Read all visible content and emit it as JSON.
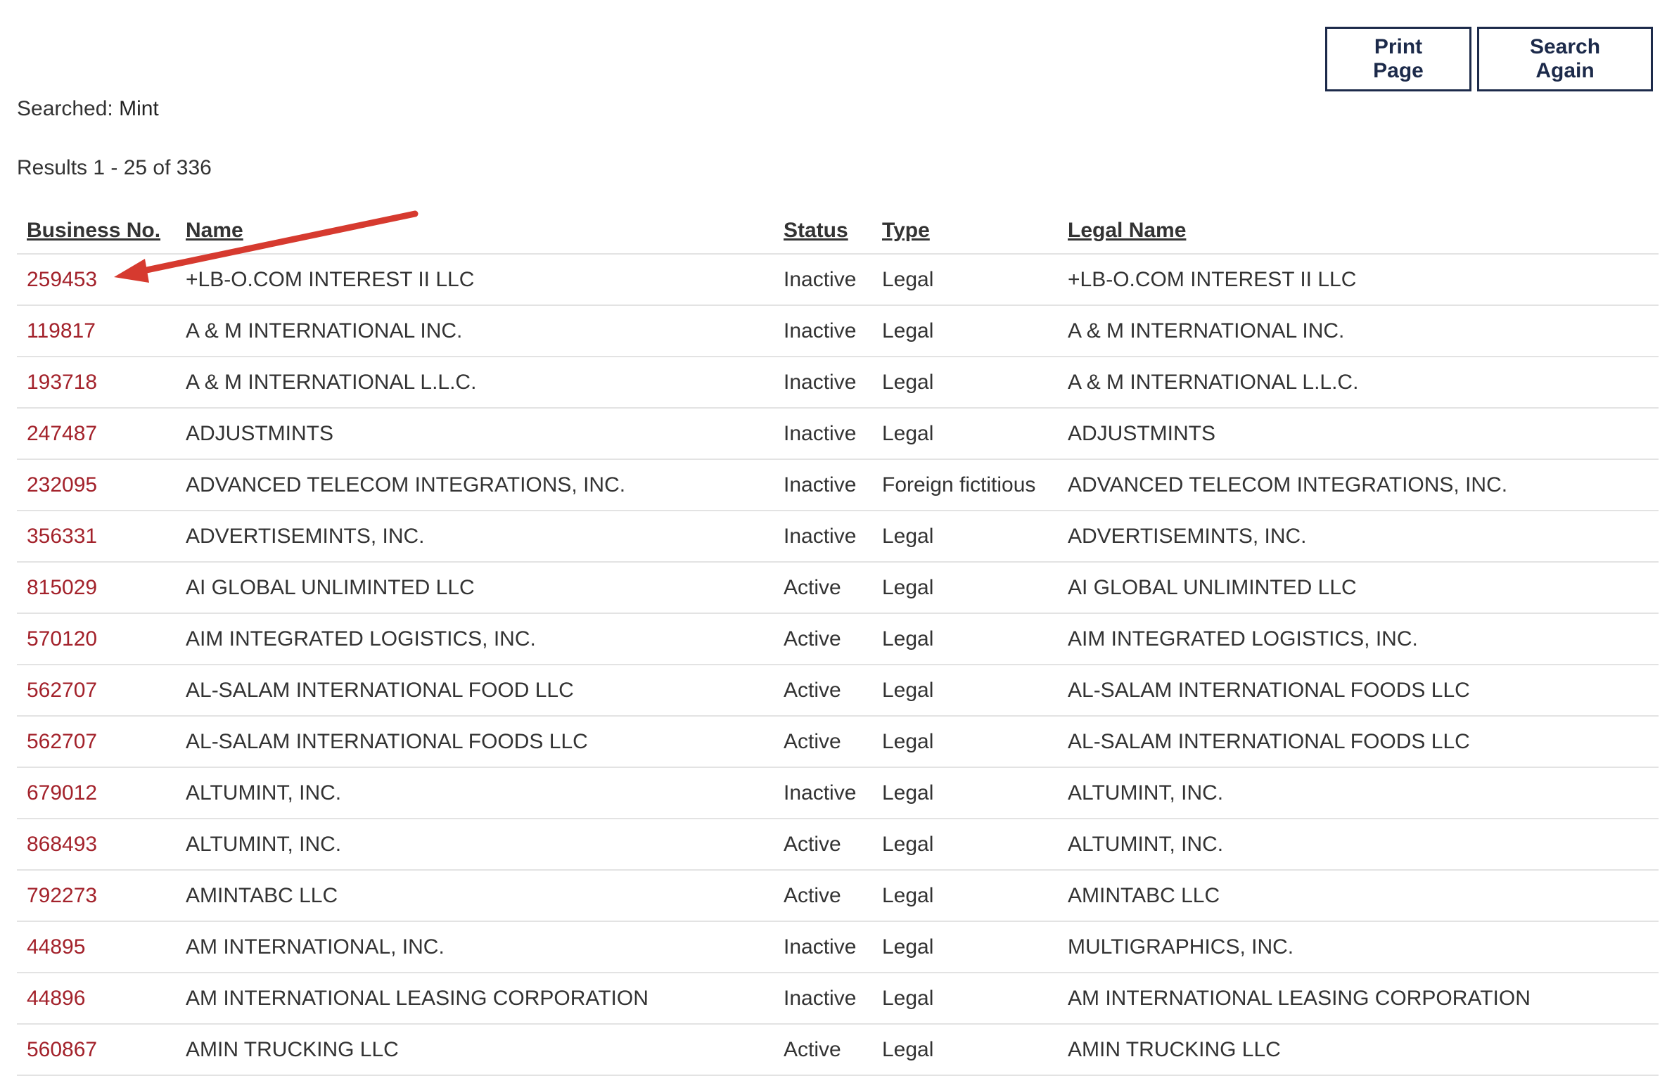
{
  "toolbar": {
    "print_label": "Print Page",
    "search_again_label": "Search Again"
  },
  "search": {
    "label": "Searched: ",
    "term": "Mint"
  },
  "results_summary": "Results 1 - 25 of 336",
  "table": {
    "headers": [
      "Business No.",
      "Name",
      "Status",
      "Type",
      "Legal Name"
    ],
    "rows": [
      {
        "no": "259453",
        "name": "+LB-O.COM INTEREST II LLC",
        "status": "Inactive",
        "type": "Legal",
        "legal": "+LB-O.COM INTEREST II LLC"
      },
      {
        "no": "119817",
        "name": "A & M INTERNATIONAL INC.",
        "status": "Inactive",
        "type": "Legal",
        "legal": "A & M INTERNATIONAL INC."
      },
      {
        "no": "193718",
        "name": "A & M INTERNATIONAL L.L.C.",
        "status": "Inactive",
        "type": "Legal",
        "legal": "A & M INTERNATIONAL L.L.C."
      },
      {
        "no": "247487",
        "name": "ADJUSTMINTS",
        "status": "Inactive",
        "type": "Legal",
        "legal": "ADJUSTMINTS"
      },
      {
        "no": "232095",
        "name": "ADVANCED TELECOM INTEGRATIONS, INC.",
        "status": "Inactive",
        "type": "Foreign fictitious",
        "legal": "ADVANCED TELECOM INTEGRATIONS, INC."
      },
      {
        "no": "356331",
        "name": "ADVERTISEMINTS, INC.",
        "status": "Inactive",
        "type": "Legal",
        "legal": "ADVERTISEMINTS, INC."
      },
      {
        "no": "815029",
        "name": "AI GLOBAL UNLIMINTED LLC",
        "status": "Active",
        "type": "Legal",
        "legal": "AI GLOBAL UNLIMINTED LLC"
      },
      {
        "no": "570120",
        "name": "AIM INTEGRATED LOGISTICS, INC.",
        "status": "Active",
        "type": "Legal",
        "legal": "AIM INTEGRATED LOGISTICS, INC."
      },
      {
        "no": "562707",
        "name": "AL-SALAM INTERNATIONAL FOOD LLC",
        "status": "Active",
        "type": "Legal",
        "legal": "AL-SALAM INTERNATIONAL FOODS LLC"
      },
      {
        "no": "562707",
        "name": "AL-SALAM INTERNATIONAL FOODS LLC",
        "status": "Active",
        "type": "Legal",
        "legal": "AL-SALAM INTERNATIONAL FOODS LLC"
      },
      {
        "no": "679012",
        "name": "ALTUMINT, INC.",
        "status": "Inactive",
        "type": "Legal",
        "legal": "ALTUMINT, INC."
      },
      {
        "no": "868493",
        "name": "ALTUMINT, INC.",
        "status": "Active",
        "type": "Legal",
        "legal": "ALTUMINT, INC."
      },
      {
        "no": "792273",
        "name": "AMINTABC LLC",
        "status": "Active",
        "type": "Legal",
        "legal": "AMINTABC LLC"
      },
      {
        "no": "44895",
        "name": "AM INTERNATIONAL, INC.",
        "status": "Inactive",
        "type": "Legal",
        "legal": "MULTIGRAPHICS, INC."
      },
      {
        "no": "44896",
        "name": "AM INTERNATIONAL LEASING CORPORATION",
        "status": "Inactive",
        "type": "Legal",
        "legal": "AM INTERNATIONAL LEASING CORPORATION"
      },
      {
        "no": "560867",
        "name": "AMIN TRUCKING LLC",
        "status": "Active",
        "type": "Legal",
        "legal": "AMIN TRUCKING LLC"
      }
    ]
  },
  "colors": {
    "link": "#a3222b",
    "button_border": "#1c2a4a",
    "arrow": "#d63a2f",
    "row_divider": "#e3e3e3"
  }
}
